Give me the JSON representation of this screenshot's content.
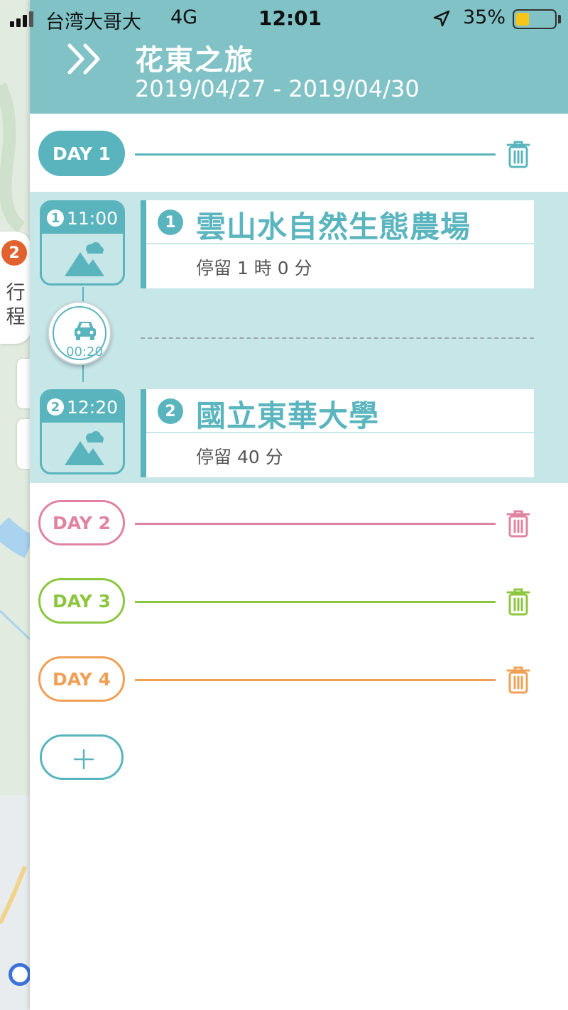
{
  "status_bar": {
    "carrier": "台湾大哥大",
    "network": "4G",
    "time": "12:01",
    "battery": "35%",
    "battery_level": 0.35
  },
  "sidebar": {
    "badge_count": "2",
    "tab_label": "行程"
  },
  "header": {
    "title": "花東之旅",
    "dates": "2019/04/27 - 2019/04/30"
  },
  "days": [
    {
      "label": "DAY 1",
      "color": "#59b4bd",
      "expanded": true
    },
    {
      "label": "DAY 2",
      "color": "#e083a0"
    },
    {
      "label": "DAY 3",
      "color": "#8cc63f"
    },
    {
      "label": "DAY 4",
      "color": "#f0a055"
    }
  ],
  "stops": [
    {
      "index": "1",
      "time": "11:00",
      "name": "雲山水自然生態農場",
      "stay": "停留 1 時 0 分"
    },
    {
      "index": "2",
      "time": "12:20",
      "name": "國立東華大學",
      "stay": "停留 40 分"
    }
  ],
  "transport": {
    "mode_icon": "car-icon",
    "duration": "00:20"
  },
  "colors": {
    "header": "#80c2c6",
    "accent": "#59b4bd",
    "day_area": "#c7e6e8",
    "badge": "#e1622e"
  }
}
